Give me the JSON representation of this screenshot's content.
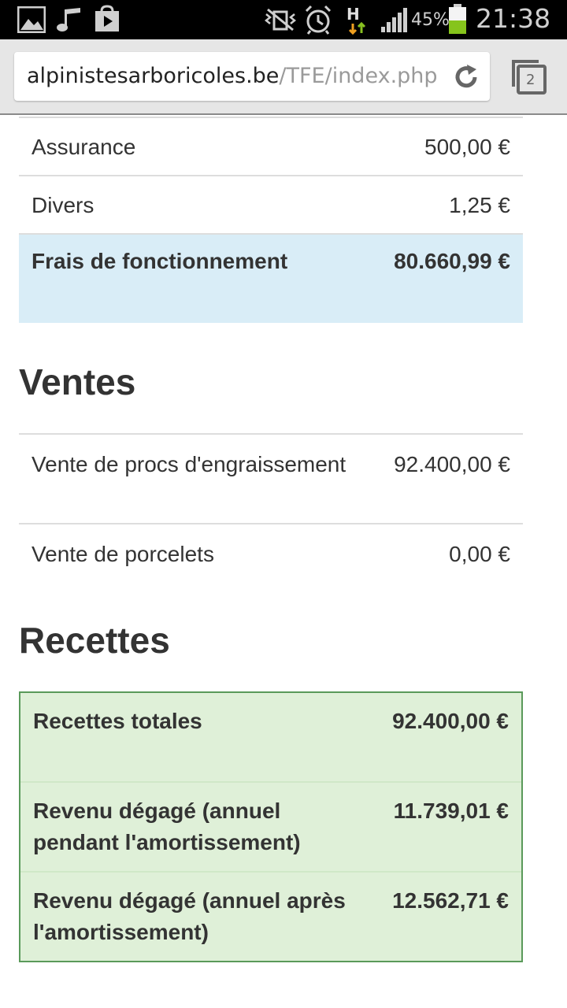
{
  "status_bar": {
    "battery_percent": "45%",
    "network_type": "H",
    "time": "21:38"
  },
  "browser": {
    "url_domain": "alpinistesarboricoles.be",
    "url_path": "/TFE/index.php",
    "tab_count": "2"
  },
  "frais": {
    "rows": [
      {
        "label": "Assurance",
        "value": "500,00 €"
      },
      {
        "label": "Divers",
        "value": "1,25 €"
      }
    ],
    "total": {
      "label": "Frais de fonctionnement",
      "value": "80.660,99 €"
    }
  },
  "ventes": {
    "heading": "Ventes",
    "rows": [
      {
        "label": "Vente de procs d'engraissement",
        "value": "92.400,00 €"
      },
      {
        "label": "Vente de porcelets",
        "value": "0,00 €"
      }
    ]
  },
  "recettes": {
    "heading": "Recettes",
    "rows": [
      {
        "label": "Recettes totales",
        "value": "92.400,00 €"
      },
      {
        "label": "Revenu dégagé (annuel pendant l'amortissement)",
        "value": "11.739,01 €"
      },
      {
        "label": "Revenu dégagé (annuel après l'amortissement)",
        "value": "12.562,71 €"
      }
    ]
  },
  "colors": {
    "total_row_bg": "#d9edf7",
    "success_row_bg": "#dff0d8",
    "success_border": "#5a9a5a"
  }
}
